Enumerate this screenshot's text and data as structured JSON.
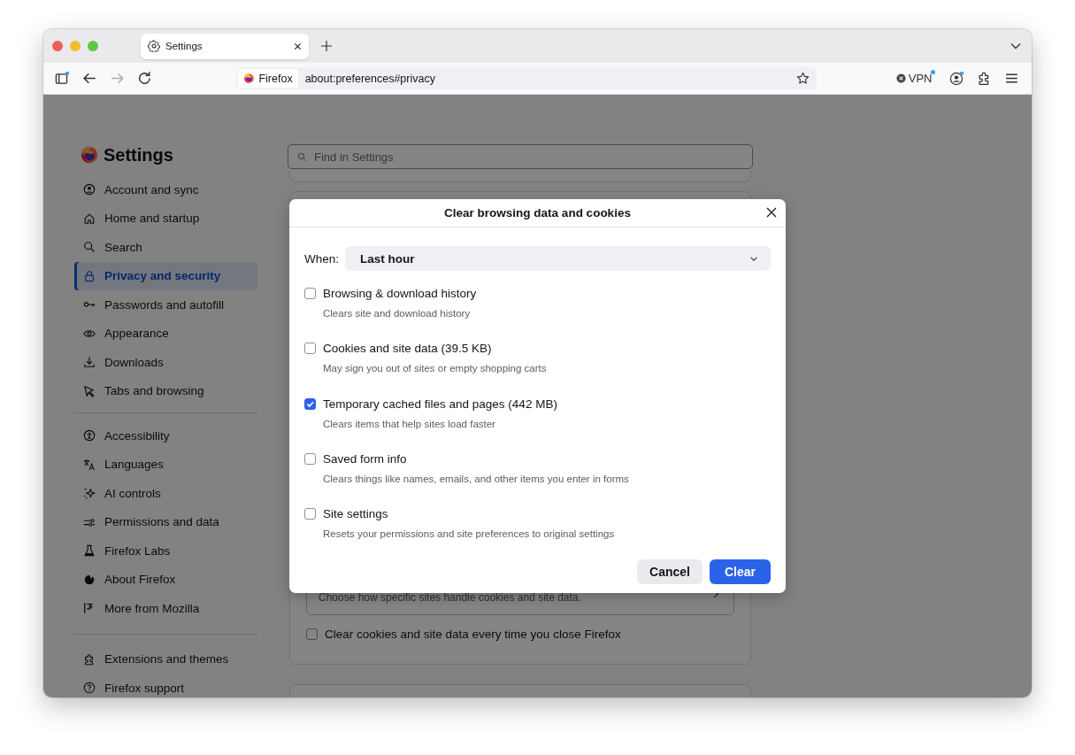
{
  "browser": {
    "tabs": [
      {
        "title": "Settings",
        "selected": true
      }
    ],
    "identity": "Firefox",
    "url": "about:preferences#privacy",
    "vpn": "VPN"
  },
  "sidebar": {
    "title": "Settings",
    "groups": [
      [
        {
          "label": "Account and sync",
          "selected": false
        },
        {
          "label": "Home and startup",
          "selected": false
        },
        {
          "label": "Search",
          "selected": false
        },
        {
          "label": "Privacy and security",
          "selected": true
        },
        {
          "label": "Passwords and autofill",
          "selected": false
        },
        {
          "label": "Appearance",
          "selected": false
        },
        {
          "label": "Downloads",
          "selected": false
        },
        {
          "label": "Tabs and browsing",
          "selected": false
        }
      ],
      [
        {
          "label": "Accessibility",
          "selected": false
        },
        {
          "label": "Languages",
          "selected": false
        },
        {
          "label": "AI controls",
          "selected": false
        },
        {
          "label": "Permissions and data",
          "selected": false
        },
        {
          "label": "Firefox Labs",
          "selected": false
        },
        {
          "label": "About Firefox",
          "selected": false
        },
        {
          "label": "More from Mozilla",
          "selected": false
        }
      ],
      [
        {
          "label": "Extensions and themes",
          "selected": false
        },
        {
          "label": "Firefox support",
          "selected": false
        }
      ]
    ]
  },
  "search": {
    "placeholder": "Find in Settings"
  },
  "background": {
    "description": "Choose how specific sites handle cookies and site data.",
    "checkbox": {
      "label": "Clear cookies and site data every time you close Firefox",
      "checked": false
    }
  },
  "dialog": {
    "title": "Clear browsing data and cookies",
    "when_label": "When:",
    "when_value": "Last hour",
    "options": [
      {
        "label": "Browsing & download history",
        "description": "Clears site and download history",
        "checked": false
      },
      {
        "label": "Cookies and site data (39.5 KB)",
        "description": "May sign you out of sites or empty shopping carts",
        "checked": false
      },
      {
        "label": "Temporary cached files and pages (442 MB)",
        "description": "Clears items that help sites load faster",
        "checked": true
      },
      {
        "label": "Saved form info",
        "description": "Clears things like names, emails, and other items you enter in forms",
        "checked": false
      },
      {
        "label": "Site settings",
        "description": "Resets your permissions and site preferences to original settings",
        "checked": false
      }
    ],
    "buttons": [
      {
        "label": "Cancel",
        "kind": "secondary"
      },
      {
        "label": "Clear",
        "kind": "primary"
      }
    ]
  }
}
